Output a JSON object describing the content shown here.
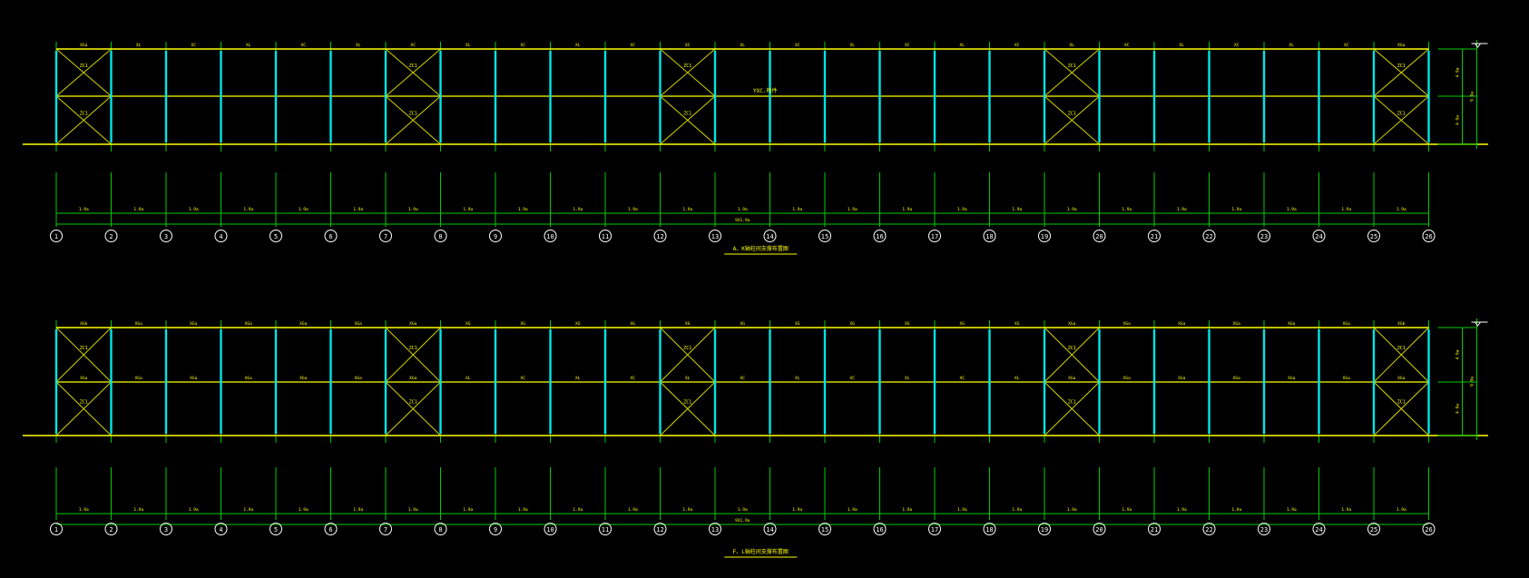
{
  "colors": {
    "background": "#000000",
    "beam": "#ffff00",
    "column": "#00e5e5",
    "grid_line": "#00cc00",
    "bracing": "#d4d400",
    "text": "#ffff00",
    "bubble": "#ffffff"
  },
  "grid_labels": [
    "1",
    "2",
    "3",
    "4",
    "5",
    "6",
    "7",
    "8",
    "9",
    "10",
    "11",
    "12",
    "13",
    "14",
    "15",
    "16",
    "17",
    "18",
    "19",
    "20",
    "21",
    "22",
    "23",
    "24",
    "25",
    "26"
  ],
  "braced_bays": [
    1,
    7,
    12,
    19,
    25
  ],
  "elevations": [
    {
      "title": "A、K轴柱间支撑布置图",
      "center_label": "YXC.构件",
      "brace_label": "ZC1",
      "top_level_mark": "",
      "top_beam_labels": [
        "XGa",
        "XL",
        "XC",
        "XL",
        "XC",
        "XL",
        "XC",
        "XL",
        "XC",
        "XL",
        "XC",
        "XC",
        "XL",
        "XC",
        "XL",
        "XC",
        "XL",
        "XC",
        "XL",
        "XC",
        "XL",
        "XC",
        "XL",
        "XC",
        "XGa"
      ],
      "mid_beam_labels": [],
      "span_labels": [
        "1.9a",
        "1.9a",
        "1.9a",
        "1.9a",
        "1.9a",
        "1.9a",
        "1.9a",
        "1.9a",
        "1.9a",
        "1.9a",
        "1.9a",
        "1.9a",
        "1.9a",
        "1.9a",
        "1.9a",
        "1.9a",
        "1.9a",
        "1.9a",
        "1.9a",
        "1.9a",
        "1.9a",
        "1.9a",
        "1.9a",
        "1.9a",
        "1.9a"
      ],
      "total_label": "9X1.9a",
      "right_dims": [
        "4.9a",
        "4.9a"
      ],
      "right_total": "9.9a"
    },
    {
      "title": "F、L轴柱间支撑布置图",
      "center_label": "",
      "brace_label": "ZC1",
      "top_level_mark": "",
      "top_beam_labels": [
        "XGb",
        "XGa",
        "XGa",
        "XGa",
        "XGa",
        "XGa",
        "XGa",
        "XG",
        "XG",
        "XG",
        "XG",
        "XG",
        "XG",
        "XG",
        "XG",
        "XG",
        "XG",
        "XG",
        "XGa",
        "XGa",
        "XGa",
        "XGa",
        "XGa",
        "XGa",
        "XGb"
      ],
      "mid_beam_labels": [
        "XGa",
        "XGa",
        "XGa",
        "XGa",
        "XGa",
        "XGa",
        "XGa",
        "XL",
        "XC",
        "XL",
        "XC",
        "XL",
        "XC",
        "XL",
        "XC",
        "XL",
        "XC",
        "XL",
        "XGa",
        "XGa",
        "XGa",
        "XGa",
        "XGa",
        "XGa",
        "XGa"
      ],
      "span_labels": [
        "1.9a",
        "1.9a",
        "1.9a",
        "1.9a",
        "1.9a",
        "1.9a",
        "1.9a",
        "1.9a",
        "1.9a",
        "1.9a",
        "1.9a",
        "1.9a",
        "1.9a",
        "1.9a",
        "1.9a",
        "1.9a",
        "1.9a",
        "1.9a",
        "1.9a",
        "1.9a",
        "1.9a",
        "1.9a",
        "1.9a",
        "1.9a",
        "1.9a"
      ],
      "total_label": "9X1.9a",
      "right_dims": [
        "4.9a",
        "4.9a"
      ],
      "right_total": "9.9a"
    }
  ]
}
